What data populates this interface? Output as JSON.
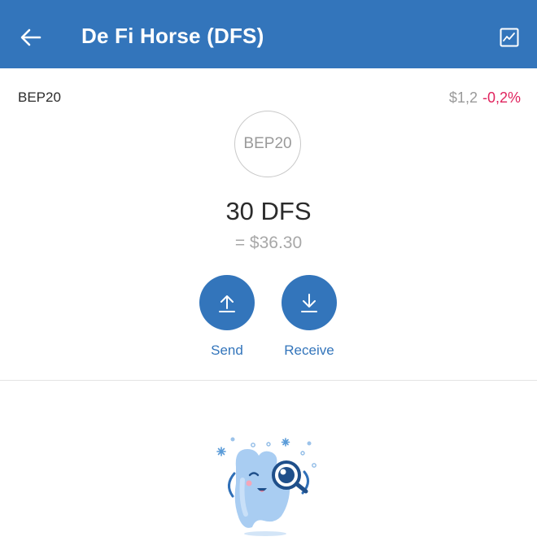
{
  "header": {
    "title": "De Fi Horse (DFS)",
    "back_icon": "arrow-left-icon",
    "chart_icon": "chart-line-icon",
    "background": "#3375bb"
  },
  "token": {
    "network": "BEP20",
    "price": "$1,2",
    "change": "-0,2%",
    "change_color": "#e0245e",
    "logo_text": "BEP20",
    "balance": "30 DFS",
    "fiat_value": "= $36.30"
  },
  "actions": {
    "send_label": "Send",
    "send_icon": "upload-arrow-icon",
    "receive_label": "Receive",
    "receive_icon": "download-arrow-icon",
    "accent": "#3375bb"
  },
  "empty_state": {
    "illustration": "mascot-magnifier-icon"
  }
}
